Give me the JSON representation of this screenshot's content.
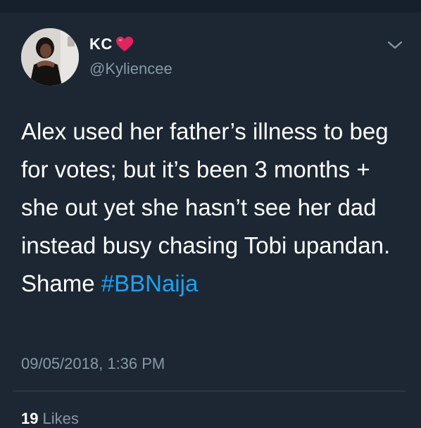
{
  "tweet": {
    "display_name": "KC",
    "handle": "@Kyliencee",
    "text": "Alex used her father’s illness to beg for votes; but it’s been 3 months + she out yet she hasn’t see her dad instead busy chasing Tobi upandan. Shame",
    "hashtag": "#BBNaija",
    "timestamp": "09/05/2018, 1:36 PM",
    "likes_count": "19",
    "likes_label": "Likes"
  },
  "icons": {
    "heart": "heart-emoji-icon",
    "chevron": "chevron-down-icon"
  },
  "colors": {
    "background": "#1c2733",
    "hashtag": "#1da1f2",
    "secondary_text": "#8899a6",
    "divider": "#38444d",
    "heart": "#e0245e"
  }
}
